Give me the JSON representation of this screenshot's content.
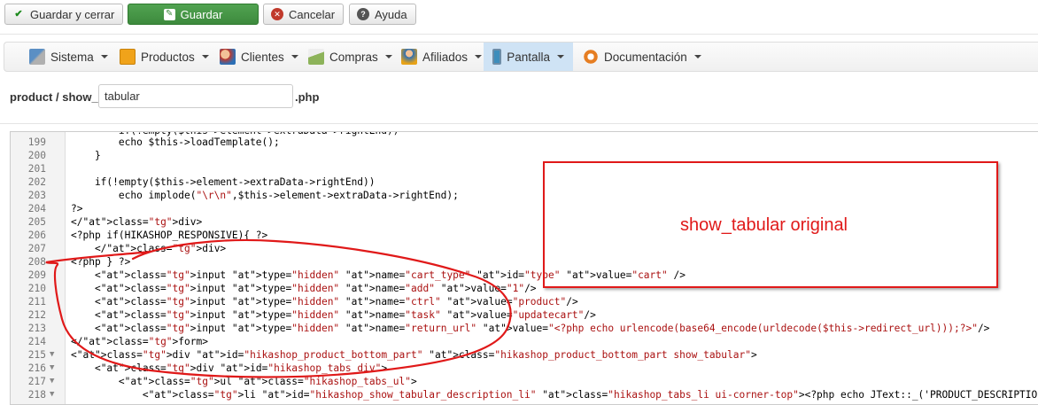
{
  "toolbar": {
    "save_close": "Guardar y cerrar",
    "save": "Guardar",
    "cancel": "Cancelar",
    "help": "Ayuda"
  },
  "menu": [
    {
      "label": "Sistema",
      "icon": "tools-icon",
      "color": "#4a7fb5"
    },
    {
      "label": "Productos",
      "icon": "box-icon",
      "color": "#e8a317"
    },
    {
      "label": "Clientes",
      "icon": "users-icon",
      "color": "#c0392b"
    },
    {
      "label": "Compras",
      "icon": "cart-icon",
      "color": "#7aa843"
    },
    {
      "label": "Afiliados",
      "icon": "people-icon",
      "color": "#2c6fb5"
    },
    {
      "label": "Pantalla",
      "icon": "display-icon",
      "color": "#3c8dbc",
      "active": true
    },
    {
      "label": "Documentación",
      "icon": "help-icon",
      "color": "#e67e22"
    }
  ],
  "file": {
    "prefix": "product / show_",
    "name": "tabular",
    "ext": ".php"
  },
  "editor": {
    "lines": [
      {
        "n": "199",
        "fold": false,
        "html": "        echo $this->loadTemplate();"
      },
      {
        "n": "200",
        "fold": false,
        "html": "    }"
      },
      {
        "n": "201",
        "fold": false,
        "html": ""
      },
      {
        "n": "202",
        "fold": false,
        "html": "    if(!empty($this->element->extraData->rightEnd))"
      },
      {
        "n": "203",
        "fold": false,
        "html": "        echo implode(\"\\r\\n\",$this->element->extraData->rightEnd);"
      },
      {
        "n": "204",
        "fold": false,
        "html": "?>"
      },
      {
        "n": "205",
        "fold": false,
        "html": "</div>"
      },
      {
        "n": "206",
        "fold": false,
        "html": "<?php if(HIKASHOP_RESPONSIVE){ ?>"
      },
      {
        "n": "207",
        "fold": false,
        "html": "    </div>"
      },
      {
        "n": "208",
        "fold": false,
        "html": "<?php } ?>"
      },
      {
        "n": "209",
        "fold": false,
        "html": "    <input type=\"hidden\" name=\"cart_type\" id=\"type\" value=\"cart\" />"
      },
      {
        "n": "210",
        "fold": false,
        "html": "    <input type=\"hidden\" name=\"add\" value=\"1\"/>"
      },
      {
        "n": "211",
        "fold": false,
        "html": "    <input type=\"hidden\" name=\"ctrl\" value=\"product\"/>"
      },
      {
        "n": "212",
        "fold": false,
        "html": "    <input type=\"hidden\" name=\"task\" value=\"updatecart\"/>"
      },
      {
        "n": "213",
        "fold": false,
        "html": "    <input type=\"hidden\" name=\"return_url\" value=\"<?php echo urlencode(base64_encode(urldecode($this->redirect_url)));?>\"/>"
      },
      {
        "n": "214",
        "fold": false,
        "html": "</form>"
      },
      {
        "n": "215",
        "fold": true,
        "html": "<div id=\"hikashop_product_bottom_part\" class=\"hikashop_product_bottom_part show_tabular\">"
      },
      {
        "n": "216",
        "fold": true,
        "html": "    <div id=\"hikashop_tabs_div\">"
      },
      {
        "n": "217",
        "fold": true,
        "html": "        <ul class=\"hikashop_tabs_ul\">"
      },
      {
        "n": "218",
        "fold": true,
        "html": "            <li id=\"hikashop_show_tabular_description_li\" class=\"hikashop_tabs_li ui-corner-top\"><?php echo JText::_('PRODUCT_DESCRIPTION');?></li>"
      }
    ]
  },
  "annotation": {
    "label": "show_tabular original",
    "color": "#e01919"
  }
}
